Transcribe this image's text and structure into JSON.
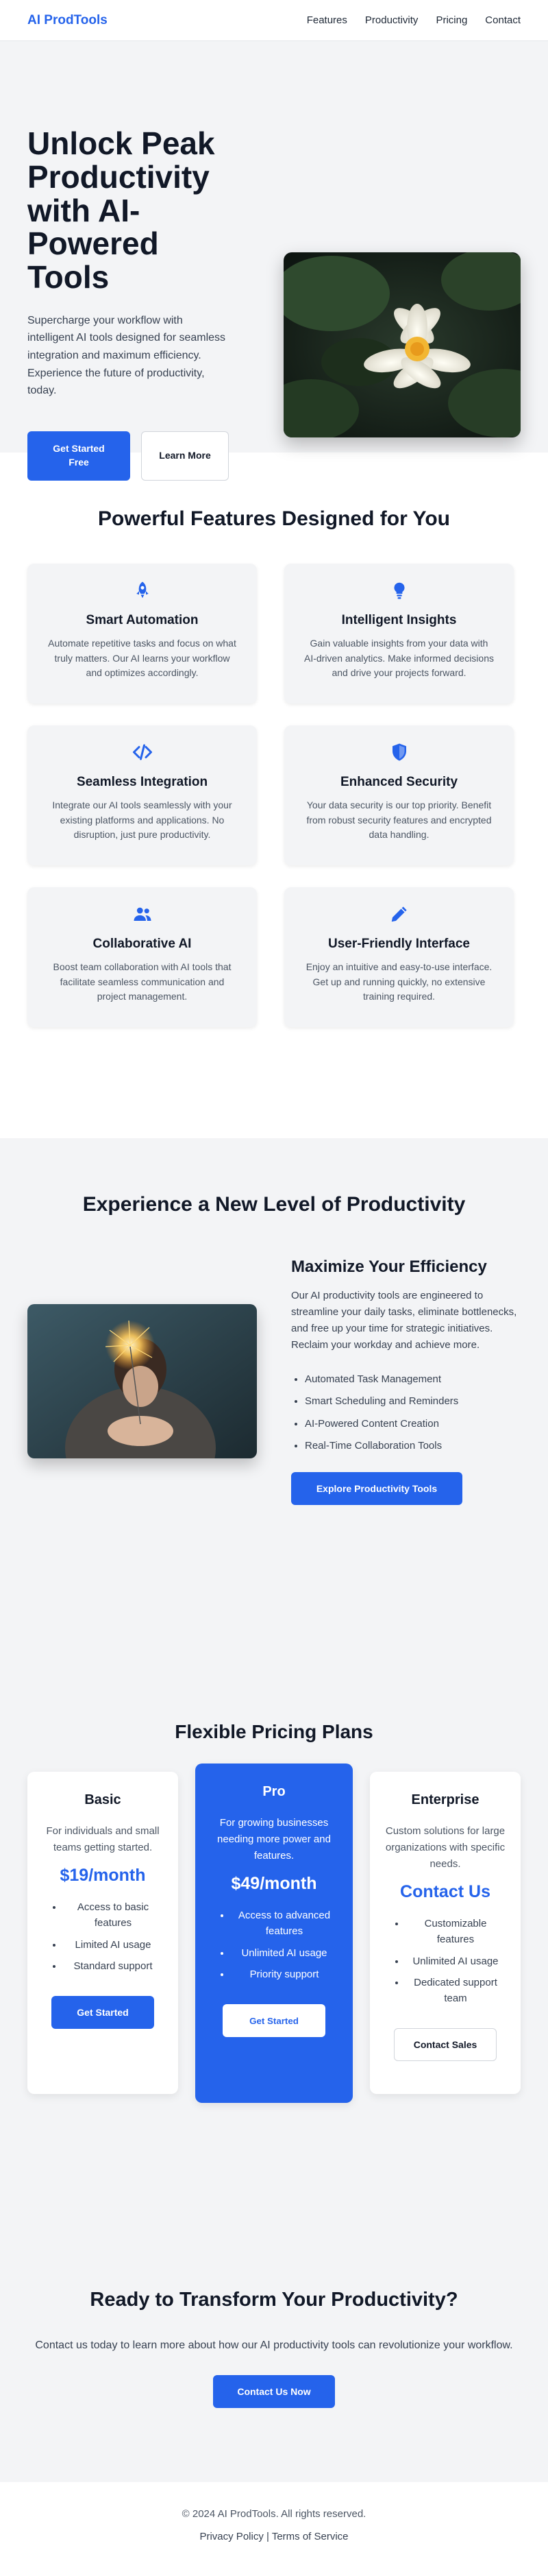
{
  "header": {
    "logo": "AI ProdTools",
    "nav": [
      "Features",
      "Productivity",
      "Pricing",
      "Contact"
    ]
  },
  "hero": {
    "title": "Unlock Peak Productivity with AI-Powered Tools",
    "subtitle": "Supercharge your workflow with intelligent AI tools designed for seamless integration and maximum efficiency. Experience the future of productivity, today.",
    "primary_button": "Get Started Free",
    "secondary_button": "Learn More"
  },
  "features": {
    "title": "Powerful Features Designed for You",
    "items": [
      {
        "icon": "rocket-icon",
        "title": "Smart Automation",
        "desc": "Automate repetitive tasks and focus on what truly matters. Our AI learns your workflow and optimizes accordingly."
      },
      {
        "icon": "lightbulb-icon",
        "title": "Intelligent Insights",
        "desc": "Gain valuable insights from your data with AI-driven analytics. Make informed decisions and drive your projects forward."
      },
      {
        "icon": "code-icon",
        "title": "Seamless Integration",
        "desc": "Integrate our AI tools seamlessly with your existing platforms and applications. No disruption, just pure productivity."
      },
      {
        "icon": "shield-icon",
        "title": "Enhanced Security",
        "desc": "Your data security is our top priority. Benefit from robust security features and encrypted data handling."
      },
      {
        "icon": "users-icon",
        "title": "Collaborative AI",
        "desc": "Boost team collaboration with AI tools that facilitate seamless communication and project management."
      },
      {
        "icon": "pencil-icon",
        "title": "User-Friendly Interface",
        "desc": "Enjoy an intuitive and easy-to-use interface. Get up and running quickly, no extensive training required."
      }
    ]
  },
  "productivity": {
    "title": "Experience a New Level of Productivity",
    "subtitle": "Maximize Your Efficiency",
    "text": "Our AI productivity tools are engineered to streamline your daily tasks, eliminate bottlenecks, and free up your time for strategic initiatives. Reclaim your workday and achieve more.",
    "list": [
      "Automated Task Management",
      "Smart Scheduling and Reminders",
      "AI-Powered Content Creation",
      "Real-Time Collaboration Tools"
    ],
    "button": "Explore Productivity Tools"
  },
  "pricing": {
    "title": "Flexible Pricing Plans",
    "plans": [
      {
        "name": "Basic",
        "desc": "For individuals and small teams getting started.",
        "price": "$19/month",
        "features": [
          "Access to basic features",
          "Limited AI usage",
          "Standard support"
        ],
        "button": "Get Started"
      },
      {
        "name": "Pro",
        "desc": "For growing businesses needing more power and features.",
        "price": "$49/month",
        "features": [
          "Access to advanced features",
          "Unlimited AI usage",
          "Priority support"
        ],
        "button": "Get Started"
      },
      {
        "name": "Enterprise",
        "desc": "Custom solutions for large organizations with specific needs.",
        "price": "Contact Us",
        "features": [
          "Customizable features",
          "Unlimited AI usage",
          "Dedicated support team"
        ],
        "button": "Contact Sales"
      }
    ]
  },
  "cta": {
    "title": "Ready to Transform Your Productivity?",
    "text": "Contact us today to learn more about how our AI productivity tools can revolutionize your workflow.",
    "button": "Contact Us Now"
  },
  "footer": {
    "copyright": "© 2024 AI ProdTools. All rights reserved.",
    "privacy": "Privacy Policy",
    "separator": "|",
    "terms": "Terms of Service"
  },
  "colors": {
    "accent": "#2563eb",
    "section_bg": "#f3f4f6",
    "heading": "#111827"
  }
}
